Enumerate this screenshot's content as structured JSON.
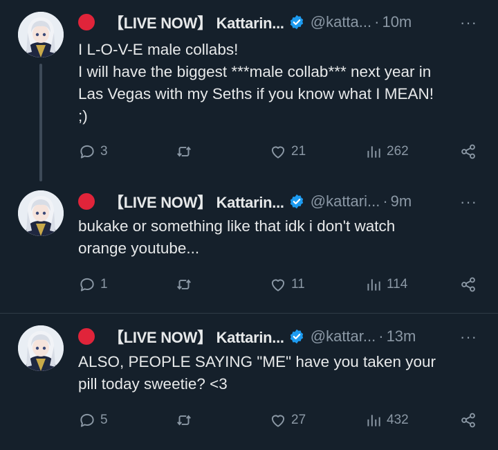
{
  "colors": {
    "background": "#15202b",
    "text": "#e7e9ea",
    "muted": "#8b98a5",
    "live_dot": "#e0243a",
    "verified": "#1d9bf0"
  },
  "icons": {
    "reply": "speech-bubble-icon",
    "repost": "repost-arrows-icon",
    "like": "heart-icon",
    "views": "bar-chart-icon",
    "share": "share-nodes-icon",
    "more": "more-dots-icon"
  },
  "tweets": [
    {
      "display_name": "【LIVE NOW】 Kattarin...",
      "handle": "@katta...",
      "time": "10m",
      "lines": [
        "I L-O-V-E male collabs!",
        "I will have the biggest ***male collab*** next year in",
        "Las Vegas with my Seths if you know what I MEAN!",
        ";)"
      ],
      "replies": "3",
      "reposts": "",
      "likes": "21",
      "views": "262"
    },
    {
      "display_name": "【LIVE NOW】 Kattarin...",
      "handle": "@kattari...",
      "time": "9m",
      "lines": [
        "bukake or something like that idk i don't watch",
        "orange youtube..."
      ],
      "replies": "1",
      "reposts": "",
      "likes": "11",
      "views": "114"
    },
    {
      "display_name": "【LIVE NOW】 Kattarin...",
      "handle": "@kattar...",
      "time": "13m",
      "lines": [
        "ALSO, PEOPLE SAYING \"ME\" have you taken your",
        "pill today sweetie? <3"
      ],
      "replies": "5",
      "reposts": "",
      "likes": "27",
      "views": "432"
    }
  ]
}
